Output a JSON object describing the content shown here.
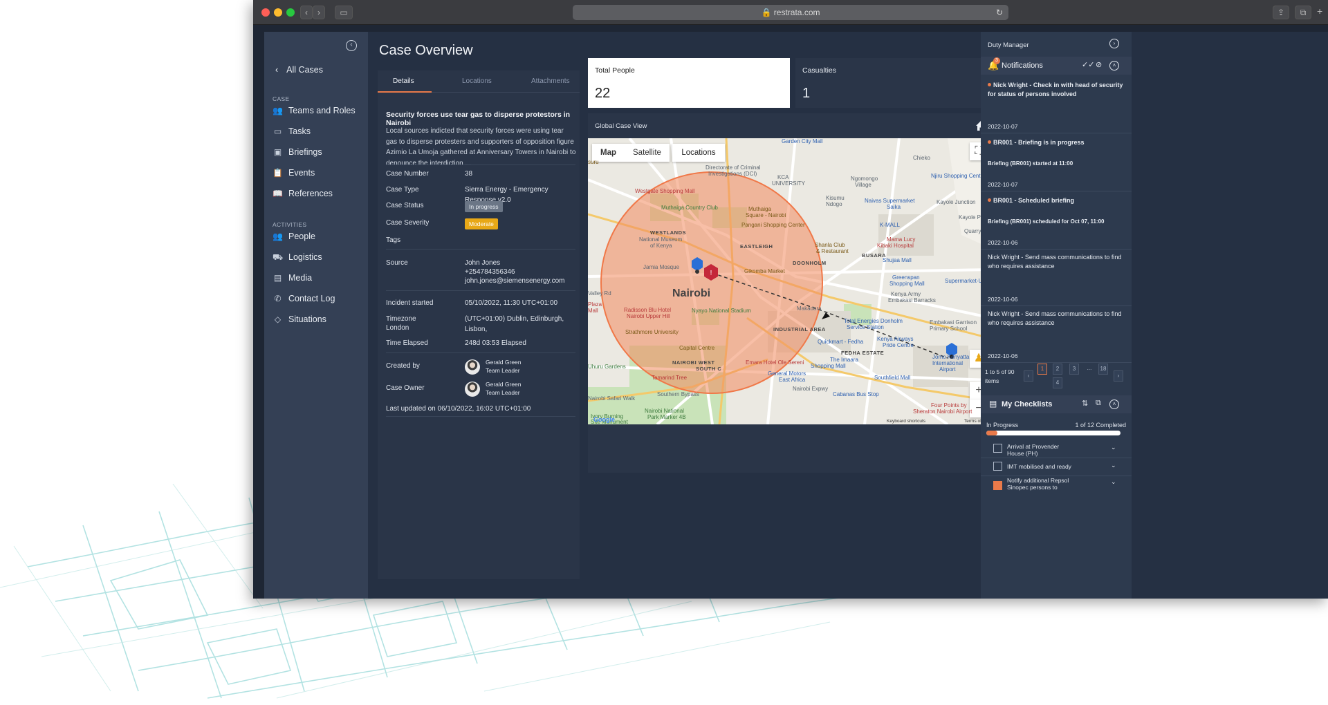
{
  "browser": {
    "url": "restrata.com"
  },
  "sidebar": {
    "back_label": "All Cases",
    "section_case": "CASE",
    "case_items": [
      {
        "label": "Teams and Roles"
      },
      {
        "label": "Tasks"
      },
      {
        "label": "Briefings"
      },
      {
        "label": "Events"
      },
      {
        "label": "References"
      }
    ],
    "section_activities": "ACTIVITIES",
    "activity_items": [
      {
        "label": "People"
      },
      {
        "label": "Logistics"
      },
      {
        "label": "Media"
      },
      {
        "label": "Contact Log"
      },
      {
        "label": "Situations"
      }
    ]
  },
  "page": {
    "title": "Case Overview"
  },
  "details": {
    "tabs": [
      "Details",
      "Locations",
      "Attachments"
    ],
    "headline": "Security forces use tear gas to disperse protestors in Nairobi",
    "description": "Local sources indicted that security forces were using tear gas to disperse protesters and supporters of opposition figure Azimio La Umoja gathered at Anniversary Towers in Nairobi to denounce the interdiction ...",
    "fields": {
      "case_number_label": "Case Number",
      "case_number": "38",
      "case_type_label": "Case Type",
      "case_type": "Sierra Energy - Emergency Response v2.0",
      "case_status_label": "Case Status",
      "case_status": "In progress",
      "case_severity_label": "Case Severity",
      "case_severity": "Moderate",
      "tags_label": "Tags",
      "source_label": "Source",
      "source_name": "John Jones",
      "source_phone": "+254784356346",
      "source_email": "john.jones@siemensenergy.com",
      "incident_label": "Incident started",
      "incident": "05/10/2022, 11:30 UTC+01:00",
      "timezone_label": "Timezone",
      "timezone_line1": "(UTC+01:00) Dublin, Edinburgh, Lisbon,",
      "timezone_line2": "London",
      "elapsed_label": "Time Elapsed",
      "elapsed": "248d 03:53 Elapsed",
      "created_by_label": "Created by",
      "created_by_name": "Gerald Green",
      "created_by_role": "Team Leader",
      "owner_label": "Case Owner",
      "owner_name": "Gerald Green",
      "owner_role": "Team Leader",
      "last_updated": "Last updated on 06/10/2022, 16:02 UTC+01:00"
    }
  },
  "stats": {
    "total_people_label": "Total People",
    "total_people": "22",
    "casualties_label": "Casualties",
    "casualties": "1"
  },
  "map": {
    "panel_title": "Global Case View",
    "type_map": "Map",
    "type_satellite": "Satellite",
    "locations_button": "Locations",
    "city_label": "Nairobi",
    "labels": {
      "l1": "Garden City Mall",
      "l2": "Chieko",
      "l3": "Directorate of Criminal",
      "l4": "Investigations (DCI)",
      "l5": "KCA",
      "l6": "UNIVERSITY",
      "l7": "Ngomongo",
      "l8": "Village",
      "l9": "Njiru Shopping Centre",
      "l10": "Westgate Shopping Mall",
      "l11": "Kisumu",
      "l12": "Ndogo",
      "l13": "Naivas Supermarket",
      "l14": "Saika",
      "l15": "Kayole Junction",
      "l16": "Muthaiga Country Club",
      "l17": "Muthaiga",
      "l18": "Square - Nairobi",
      "l19": "Pangani Shopping Center",
      "l20": "Kayole Police",
      "l21": "K-MALL",
      "l22": "Quarry",
      "l23": "WESTLANDS",
      "l24": "National Museum",
      "l25": "of Kenya",
      "l26": "EASTLEIGH",
      "l27": "Shanla Club",
      "l28": "& Restaurant",
      "l29": "Mama Lucy",
      "l30": "Kibaki Hospital",
      "l31": "BUSARA",
      "l32": "Jamia Mosque",
      "l33": "DOONHOLM",
      "l34": "Shujaa Mall",
      "l35": "Gikomba Market",
      "l36": "Greenspan",
      "l37": "Shopping Mall",
      "l38": "Supermarket-Utawala",
      "l39": "Kenya Army",
      "l40": "Embakasi Barracks",
      "l41": "Radisson Blu Hotel",
      "l42": "Nairobi Upper Hill",
      "l43": "Nyayo National Stadium",
      "l44": "Makadara",
      "l45": "Total Energies Donholm",
      "l46": "Service Station",
      "l47": "Embakasi Garrison",
      "l48": "Primary School",
      "l49": "INDUSTRIAL AREA",
      "l50": "Strathmore University",
      "l51": "Kenya Airways",
      "l52": "Pride Centre",
      "l53": "Quickmart - Fedha",
      "l54": "Capital Centre",
      "l55": "FEDHA ESTATE",
      "l56": "Uhuru Gardens",
      "l57": "NAIROBI WEST",
      "l58": "SOUTH C",
      "l59": "Emara Hotel Ole Sereni",
      "l60": "The Imaara",
      "l61": "Shopping Mall",
      "l62": "Jomo Kenyatta",
      "l63": "International",
      "l64": "Airport",
      "l65": "Tamarind Tree",
      "l66": "General Motors",
      "l67": "East Africa",
      "l68": "Southfield Mall",
      "l69": "Nairobi Expwy",
      "l70": "Cabanas Bus Stop",
      "l71": "Nairobi Safari Walk",
      "l72": "Southern Bypass",
      "l73": "Nairobi National",
      "l74": "Park Marker 4B",
      "l75": "Four Points by",
      "l76": "Sheraton Nairobi Airport",
      "l77": "Ivory Burning",
      "l78": "Site Monument",
      "l79": "Google",
      "l80": "Keyboard shortcuts",
      "l81": "Terms of Use",
      "l82": "Plaza",
      "l83": "Mall",
      "l84": "Valley Rd",
      "l85": "suru"
    }
  },
  "right": {
    "duty_manager": "Duty Manager",
    "notifications_title": "Notifications",
    "notifications_count": "3",
    "items": [
      {
        "text": "Nick Wright - Check in with head of security for status of persons involved",
        "date": "2022-10-07",
        "sub": ""
      },
      {
        "text": "BR001 - Briefing is in progress",
        "sub": "Briefing (BR001) started at 11:00",
        "date": "2022-10-07"
      },
      {
        "text": "BR001 - Scheduled briefing",
        "sub": "Briefing (BR001) scheduled for Oct 07, 11:00",
        "date": "2022-10-06"
      },
      {
        "text": "Nick Wright - Send mass communications to find who requires assistance",
        "date": "2022-10-06",
        "sub": ""
      },
      {
        "text": "Nick Wright - Send mass communications to find who requires assistance",
        "date": "2022-10-06",
        "sub": ""
      }
    ],
    "pager_line1": "1 to 5 of 90",
    "pager_line2": "items",
    "pages": [
      "1",
      "2",
      "3",
      "...",
      "18",
      "4"
    ],
    "checklists_title": "My Checklists",
    "progress_label": "In Progress",
    "progress_count": "1 of 12 Completed",
    "progress_fraction": 0.0833,
    "checklist_items": [
      {
        "line1": "Arrival at Provender",
        "line2": "House (PH)"
      },
      {
        "line1": "IMT mobilised and ready",
        "line2": ""
      },
      {
        "line1": "Notify additional Repsol",
        "line2": "Sinopec persons to"
      }
    ]
  },
  "colors": {
    "accent": "#e97a4a",
    "moderate": "#e8a817",
    "impact_circle": "#f28a5e"
  }
}
